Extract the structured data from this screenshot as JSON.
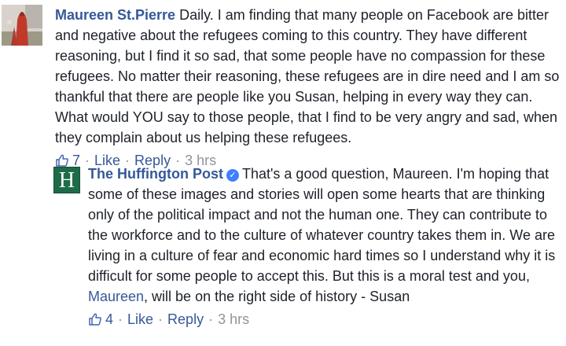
{
  "comments": [
    {
      "author": "Maureen St.Pierre",
      "text": "Daily. I am finding that many people on Facebook are bitter and negative about the refugees coming to this country. They have different reasoning, but I find it so sad, that some people have no compassion for these refugees. No matter their reasoning, these refugees are in dire need and I am so thankful that there are people like you Susan, helping in every way they can. What would YOU say to those people, that I find to be very angry and sad, when they complain about us helping these refugees.",
      "like_count": "7",
      "like_label": "Like",
      "reply_label": "Reply",
      "time": "3 hrs",
      "separator": "·",
      "avatar_icon": "profile-photo"
    },
    {
      "author": "The Huffington Post",
      "avatar_letter": "H",
      "verified_icon": "verified-check-icon",
      "text_before": "That's a good question, Maureen. I'm hoping that some of these images and stories will open some hearts that are thinking only of the political impact and not the human one. They can contribute to the workforce and to the culture of whatever country takes them in. We are living in a culture of fear and economic hard times so I understand why it is difficult for some people to accept this. But this is a moral test and you, ",
      "mention": "Maureen",
      "text_after": ", will be on the right side of history - Susan",
      "like_count": "4",
      "like_label": "Like",
      "reply_label": "Reply",
      "time": "3 hrs",
      "separator": "·"
    }
  ],
  "colors": {
    "link": "#365899",
    "text": "#1d2129",
    "meta_gray": "#90949c",
    "huffpost_green": "#1e6b48",
    "verified_blue": "#4080ff"
  }
}
